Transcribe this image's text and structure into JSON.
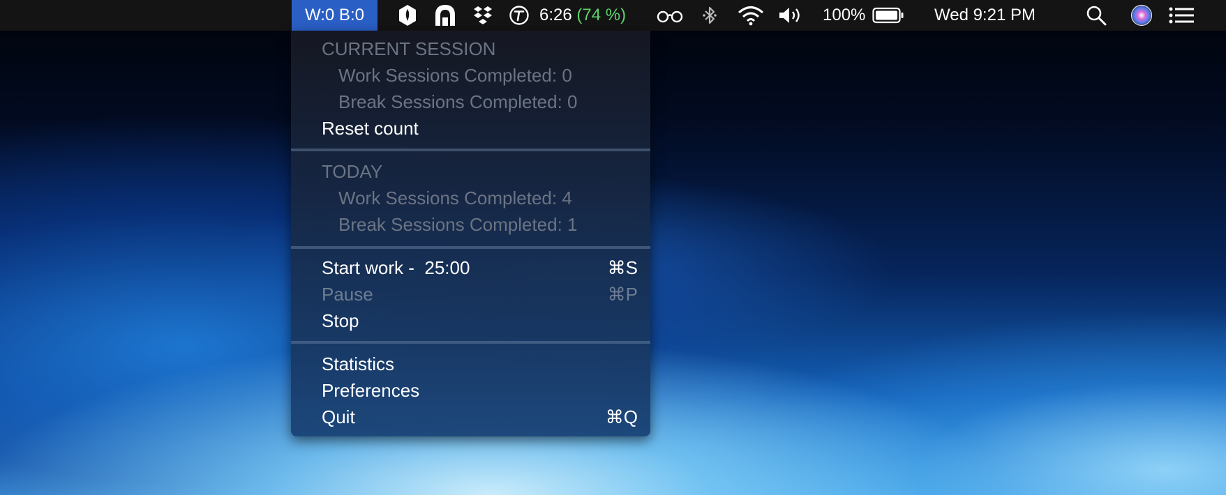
{
  "menubar": {
    "active_app": "W:0 B:0",
    "battery_timer": "6:26",
    "battery_timer_pct": "(74 %)",
    "battery_pct": "100%",
    "clock": "Wed 9:21 PM",
    "icons": [
      "pen-nib-icon",
      "arch-icon",
      "dropbox-icon",
      "timer-t-icon",
      "glasses-icon",
      "bluetooth-icon",
      "wifi-icon",
      "volume-icon",
      "battery-icon",
      "spotlight-search-icon",
      "siri-icon",
      "notification-center-icon"
    ],
    "colors": {
      "bar": "#141415",
      "active": "#2a5fc6",
      "pct_green": "#5fd36a"
    }
  },
  "menu": {
    "current_session": {
      "header": "CURRENT SESSION",
      "work": "Work Sessions Completed: 0",
      "break": "Break Sessions Completed: 0",
      "reset": "Reset count"
    },
    "today": {
      "header": "TODAY",
      "work": "Work Sessions Completed: 4",
      "break": "Break Sessions Completed: 1"
    },
    "controls": {
      "start_label": "Start work -  25:00",
      "start_shortcut": "⌘S",
      "pause_label": "Pause",
      "pause_shortcut": "⌘P",
      "stop_label": "Stop"
    },
    "app": {
      "statistics": "Statistics",
      "preferences": "Preferences",
      "quit_label": "Quit",
      "quit_shortcut": "⌘Q"
    }
  }
}
